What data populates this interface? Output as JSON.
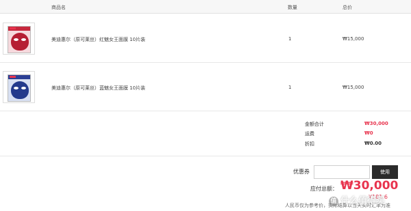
{
  "table": {
    "col_name": "商品名",
    "col_qty": "数量",
    "col_price": "总价"
  },
  "items": [
    {
      "name": "美迪惠尔（原可莱丝）红魅女王面膜 10片装",
      "qty": "1",
      "price": "₩15,000",
      "thumb_color": "#c7283d"
    },
    {
      "name": "美迪惠尔（原可莱丝）蓝魅女王面膜 10片装",
      "qty": "1",
      "price": "₩15,000",
      "thumb_color": "#2c3f94"
    }
  ],
  "summary": {
    "subtotal_label": "金额合计",
    "subtotal_value": "₩30,000",
    "shipping_label": "运费",
    "shipping_value": "₩0",
    "discount_label": "折扣",
    "discount_value": "₩0.00"
  },
  "coupon": {
    "label": "优惠券",
    "input_value": "",
    "button_label": "使用"
  },
  "payment": {
    "label": "应付总额：",
    "total": "₩30,000",
    "sub_amount": "¥181.6",
    "note": "人民币仅为参考价，实际结算以当天实时汇率为准"
  },
  "watermark": {
    "text": "什么值得买"
  },
  "colors": {
    "accent": "#e8344e",
    "button_bg": "#2b2b2b",
    "header_bg": "#f7f7f7"
  }
}
